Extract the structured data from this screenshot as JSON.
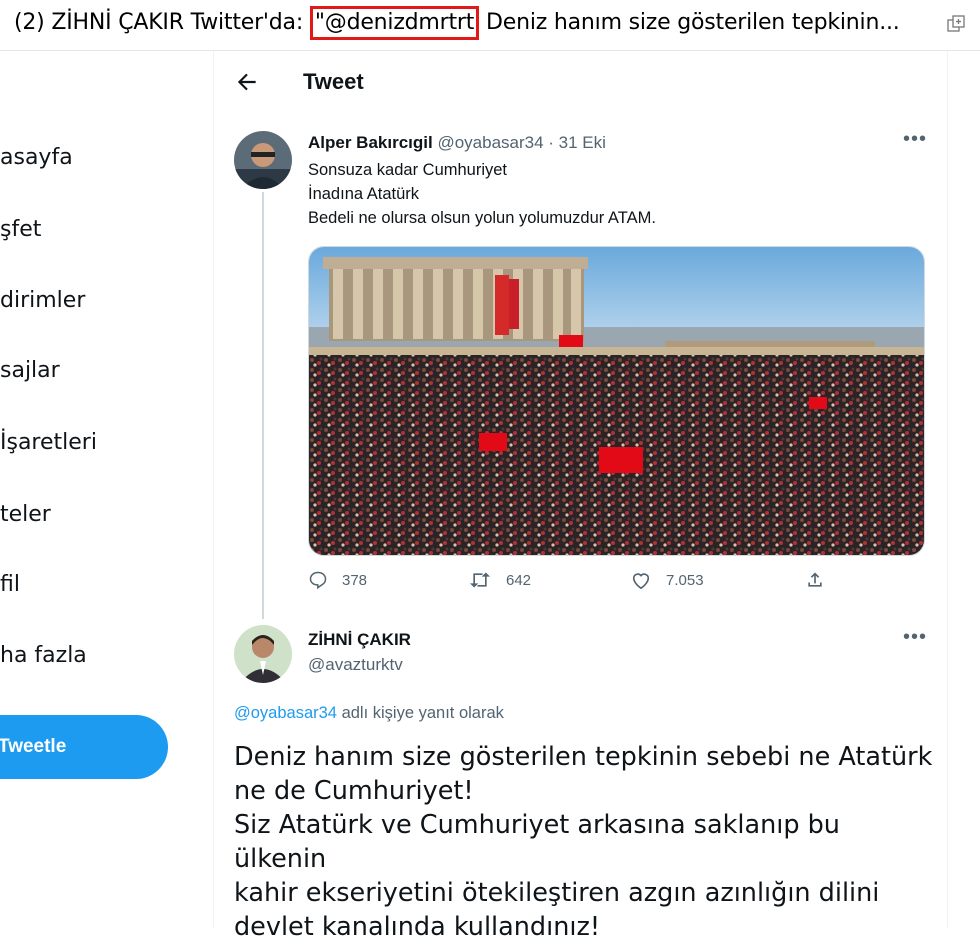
{
  "window": {
    "title_prefix": "(2) ZİHNİ ÇAKIR Twitter'da: ",
    "title_highlight": "\"@denizdmrtrt",
    "title_suffix": " Deniz hanım size gösterilen tepkinin..."
  },
  "sidebar": {
    "items": [
      {
        "label": "asayfa"
      },
      {
        "label": "şfet"
      },
      {
        "label": "dirimler"
      },
      {
        "label": "sajlar"
      },
      {
        "label": " İşaretleri"
      },
      {
        "label": "teler"
      },
      {
        "label": "fil"
      },
      {
        "label": "ha fazla"
      }
    ],
    "tweet_button": "Tweetle"
  },
  "header": {
    "title": "Tweet"
  },
  "quoted_tweet": {
    "author": "Alper Bakırcıgil",
    "handle": "@oyabasar34",
    "time": " · 31 Eki",
    "lines": [
      "Sonsuza kadar Cumhuriyet",
      "İnadına Atatürk",
      "Bedeli ne olursa olsun yolun yolumuzdur ATAM."
    ],
    "stats": {
      "replies": "378",
      "retweets": "642",
      "likes": "7.053"
    }
  },
  "main_tweet": {
    "author": "ZİHNİ ÇAKIR",
    "handle": "@avazturktv",
    "reply_mention": "@oyabasar34",
    "reply_suffix": " adlı kişiye yanıt olarak",
    "text_lines": [
      "Deniz hanım size gösterilen tepkinin sebebi ne Atatürk",
      "ne de Cumhuriyet!",
      "Siz Atatürk ve Cumhuriyet arkasına saklanıp bu ülkenin",
      "kahir ekseriyetini ötekileştiren azgın azınlığın dilini",
      "devlet kanalında kullandınız!"
    ]
  },
  "colors": {
    "accent": "#1d9bf0",
    "highlight_border": "#e11919",
    "muted": "#536471"
  }
}
